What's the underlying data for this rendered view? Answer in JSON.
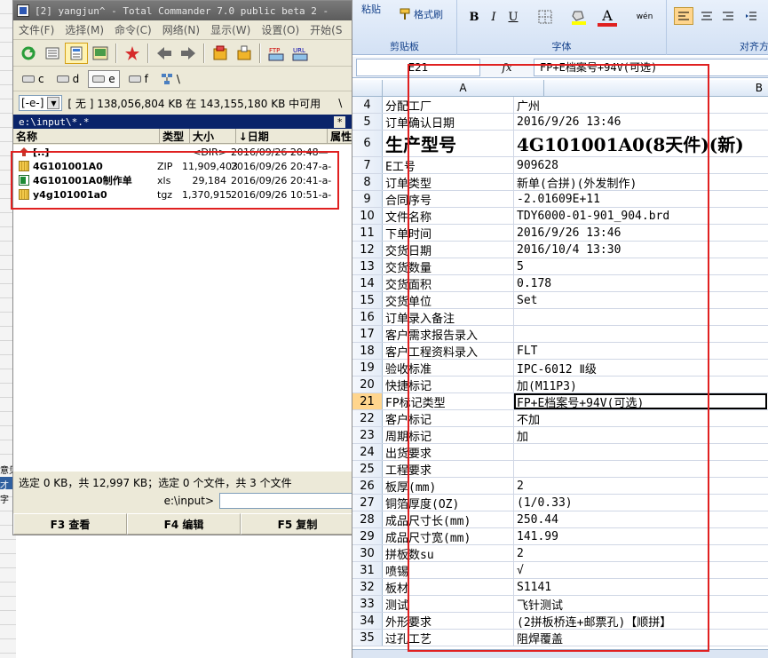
{
  "background_app": {
    "row_text_1": "意见",
    "row_text_2": "才",
    "row_text_3": "字"
  },
  "tc": {
    "title": "[2] yangjun^ - Total Commander 7.0 public beta 2 -",
    "menu": [
      "文件(F)",
      "选择(M)",
      "命令(C)",
      "网络(N)",
      "显示(W)",
      "设置(O)",
      "开始(S"
    ],
    "drives": [
      {
        "letter": "c"
      },
      {
        "letter": "d"
      },
      {
        "letter": "e"
      },
      {
        "letter": "f"
      },
      {
        "letter": "\\"
      }
    ],
    "drive_combo": "[-e-]",
    "disk_info": "[ 无 ]  138,056,804 KB 在 143,155,180 KB 中可用",
    "info_backslash": "\\",
    "path": "e:\\input\\*.*",
    "path_star": "*",
    "columns": {
      "name": "名称",
      "type": "类型",
      "size": "大小",
      "date": "↓日期",
      "attr": "属性"
    },
    "files": [
      {
        "name": "[..]",
        "type": "",
        "size": "<DIR>",
        "date": "2016/09/26 20:48—",
        "icon": "up-folder-icon"
      },
      {
        "name": "4G101001A0",
        "type": "ZIP",
        "size": "11,909,403",
        "date": "2016/09/26 20:47-a-",
        "icon": "zip-icon"
      },
      {
        "name": "4G101001A0制作单",
        "type": "xls",
        "size": "29,184",
        "date": "2016/09/26 20:41-a-",
        "icon": "xls-icon"
      },
      {
        "name": "y4g101001a0",
        "type": "tgz",
        "size": "1,370,915",
        "date": "2016/09/26 10:51-a-",
        "icon": "zip-icon"
      }
    ],
    "status": "选定 0 KB，共 12,997 KB；选定 0 个文件，共 3 个文件",
    "cmd_label": "e:\\input>",
    "fkeys": [
      "F3 查看",
      "F4 编辑",
      "F5 复制"
    ]
  },
  "excel": {
    "ribbon": {
      "paste": "粘贴",
      "format_painter": "格式刷",
      "clipboard_group": "剪贴板",
      "font_group": "字体",
      "align_group": "对齐方",
      "bold": "B",
      "italic": "I",
      "underline": "U",
      "font_color": "A",
      "wen": "wén"
    },
    "namebox": "E21",
    "formula": "FP+E档案号+94V(可选)",
    "col_a": "A",
    "col_b": "B",
    "selected_row": "21",
    "rows": [
      {
        "n": "4",
        "a": "分配工厂",
        "b": "广州"
      },
      {
        "n": "5",
        "a": "订单确认日期",
        "b": "2016/9/26 13:46"
      },
      {
        "n": "6",
        "a": "生产型号",
        "b": "4G101001A0(8天件)(新)"
      },
      {
        "n": "7",
        "a": "E工号",
        "b": "909628"
      },
      {
        "n": "8",
        "a": "订单类型",
        "b": "新单(合拼)(外发制作)"
      },
      {
        "n": "9",
        "a": "合同序号",
        "b": "-2.01609E+11"
      },
      {
        "n": "10",
        "a": "文件名称",
        "b": "TDY6000-01-901_904.brd"
      },
      {
        "n": "11",
        "a": "下单时间",
        "b": "2016/9/26 13:46"
      },
      {
        "n": "12",
        "a": "交货日期",
        "b": "2016/10/4 13:30"
      },
      {
        "n": "13",
        "a": "交货数量",
        "b": "5"
      },
      {
        "n": "14",
        "a": "交货面积",
        "b": "0.178"
      },
      {
        "n": "15",
        "a": "交货单位",
        "b": "Set"
      },
      {
        "n": "16",
        "a": "订单录入备注",
        "b": ""
      },
      {
        "n": "17",
        "a": "客户需求报告录入",
        "b": ""
      },
      {
        "n": "18",
        "a": "客户工程资料录入",
        "b": "FLT"
      },
      {
        "n": "19",
        "a": "验收标准",
        "b": "IPC-6012 Ⅱ级"
      },
      {
        "n": "20",
        "a": "快捷标记",
        "b": "加(M11P3)"
      },
      {
        "n": "21",
        "a": "FP标记类型",
        "b": "FP+E档案号+94V(可选)"
      },
      {
        "n": "22",
        "a": "客户标记",
        "b": "不加"
      },
      {
        "n": "23",
        "a": "周期标记",
        "b": "加"
      },
      {
        "n": "24",
        "a": "出货要求",
        "b": ""
      },
      {
        "n": "25",
        "a": "工程要求",
        "b": ""
      },
      {
        "n": "26",
        "a": "板厚(mm)",
        "b": "2"
      },
      {
        "n": "27",
        "a": "铜箔厚度(OZ)",
        "b": " (1/0.33)"
      },
      {
        "n": "28",
        "a": "成品尺寸长(mm)",
        "b": "250.44"
      },
      {
        "n": "29",
        "a": "成品尺寸宽(mm)",
        "b": "141.99"
      },
      {
        "n": "30",
        "a": "拼板数su",
        "b": "2"
      },
      {
        "n": "31",
        "a": "喷锡",
        "b": "√"
      },
      {
        "n": "32",
        "a": "板材",
        "b": "S1141"
      },
      {
        "n": "33",
        "a": "测试",
        "b": "飞针测试"
      },
      {
        "n": "34",
        "a": "外形要求",
        "b": "(2拼板桥连+邮票孔)【顺拼】"
      },
      {
        "n": "35",
        "a": "过孔工艺",
        "b": "阻焊覆盖"
      }
    ]
  },
  "colors": {
    "highlight_box": "#e02020",
    "tc_path_bar": "#0a246a",
    "excel_ribbon": "#d3e1f4",
    "selected_row_header": "#ffd58d"
  }
}
